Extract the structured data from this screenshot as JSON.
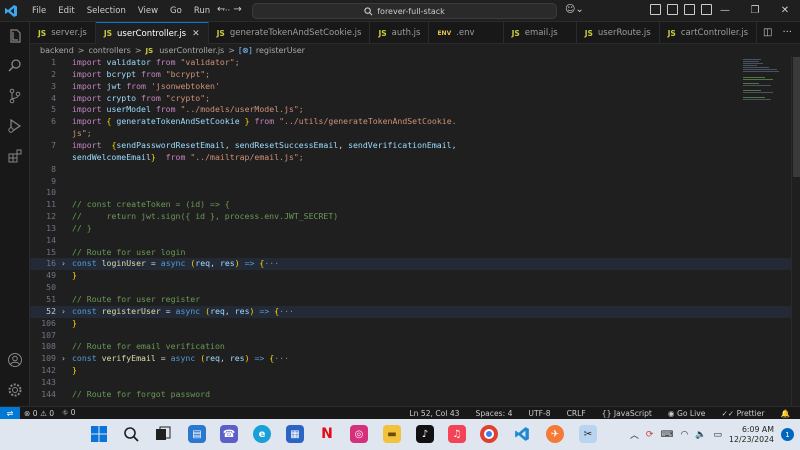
{
  "titlebar": {
    "menu": [
      "File",
      "Edit",
      "Selection",
      "View",
      "Go",
      "Run",
      "···"
    ],
    "search_text": "forever-full-stack"
  },
  "tabs": [
    {
      "label": "server.js",
      "type": "JS"
    },
    {
      "label": "userController.js",
      "type": "JS",
      "active": true
    },
    {
      "label": "generateTokenAndSetCookie.js",
      "type": "JS"
    },
    {
      "label": "auth.js",
      "type": "JS"
    },
    {
      "label": ".env",
      "type": "ENV"
    },
    {
      "label": "email.js",
      "type": "JS"
    },
    {
      "label": "userRoute.js",
      "type": "JS"
    },
    {
      "label": "cartController.js",
      "type": "JS"
    }
  ],
  "breadcrumb": {
    "folder1": "backend",
    "folder2": "controllers",
    "file": "userController.js",
    "symbol": "registerUser",
    "sep": ">"
  },
  "editor": {
    "lines": [
      {
        "n": "1"
      },
      {
        "n": "2"
      },
      {
        "n": "3"
      },
      {
        "n": "4"
      },
      {
        "n": "5"
      },
      {
        "n": "6"
      },
      {
        "n": ""
      },
      {
        "n": "7"
      },
      {
        "n": ""
      },
      {
        "n": "8"
      },
      {
        "n": "9"
      },
      {
        "n": "10"
      },
      {
        "n": "11"
      },
      {
        "n": "12"
      },
      {
        "n": "13"
      },
      {
        "n": "14"
      },
      {
        "n": "15"
      },
      {
        "n": "16"
      },
      {
        "n": "49"
      },
      {
        "n": "50"
      },
      {
        "n": "51"
      },
      {
        "n": "52"
      },
      {
        "n": "106"
      },
      {
        "n": "107"
      },
      {
        "n": "108"
      },
      {
        "n": "109"
      },
      {
        "n": "142"
      },
      {
        "n": "143"
      },
      {
        "n": "144"
      }
    ],
    "t": {
      "import": "import",
      "from": "from",
      "const": "const",
      "async": "async",
      "validator": "validator",
      "bcrypt": "bcrypt",
      "jwt": "jwt",
      "crypto": "crypto",
      "userModel": "userModel",
      "s_validator": "\"validator\";",
      "s_bcrypt": "\"bcrypt\";",
      "s_jwt": "'jsonwebtoken'",
      "s_crypto": "\"crypto\";",
      "s_usermodel": "\"../models/userModel.js\";",
      "gen_token": "generateTokenAndSetCookie",
      "s_gen_a": "\"../utils/generateTokenAndSetCookie.",
      "s_gen_b": "js\";",
      "send_reset": "sendPasswordResetEmail",
      "send_success": "sendResetSuccessEmail",
      "send_verify": "sendVerificationEmail",
      "send_welcome": "sendWelcomeEmail",
      "s_mailtrap": "\"../mailtrap/email.js\";",
      "c11": "// const createToken = (id) => {",
      "c12": "//     return jwt.sign({ id }, process.env.JWT_SECRET)",
      "c13": "// }",
      "c15": "// Route for user login",
      "c50": "// Route for user register",
      "c107": "// Route for email verification",
      "c144": "// Route for forgot password",
      "loginUser": "loginUser",
      "registerUser": "registerUser",
      "verifyEmail": "verifyEmail",
      "req": "req",
      "res": "res",
      "ellipsis": "···"
    }
  },
  "status": {
    "errors": "0",
    "warnings": "0",
    "ports": "0",
    "position": "Ln 52, Col 43",
    "spaces": "Spaces: 4",
    "encoding": "UTF-8",
    "eol": "CRLF",
    "language": "JavaScript",
    "golive": "Go Live",
    "prettier": "Prettier"
  },
  "taskbar": {
    "time": "6:09 AM",
    "date": "12/23/2024",
    "notifications": "1",
    "apps": [
      "start-icon",
      "search-icon",
      "task-view-icon",
      "widgets-icon",
      "teams-icon",
      "edge-icon",
      "store-icon",
      "netflix-icon",
      "instagram-icon",
      "file-explorer-icon",
      "tiktok-icon",
      "apple-music-icon",
      "chrome-icon",
      "vscode-icon",
      "postman-icon",
      "snipping-tool-icon"
    ]
  },
  "colors": {
    "keyword": "#c586c0",
    "storage": "#569cd6",
    "string": "#ce9178",
    "variable": "#9cdcfe",
    "function": "#dcdcaa",
    "comment": "#6a9955",
    "accent": "#0078d4"
  }
}
